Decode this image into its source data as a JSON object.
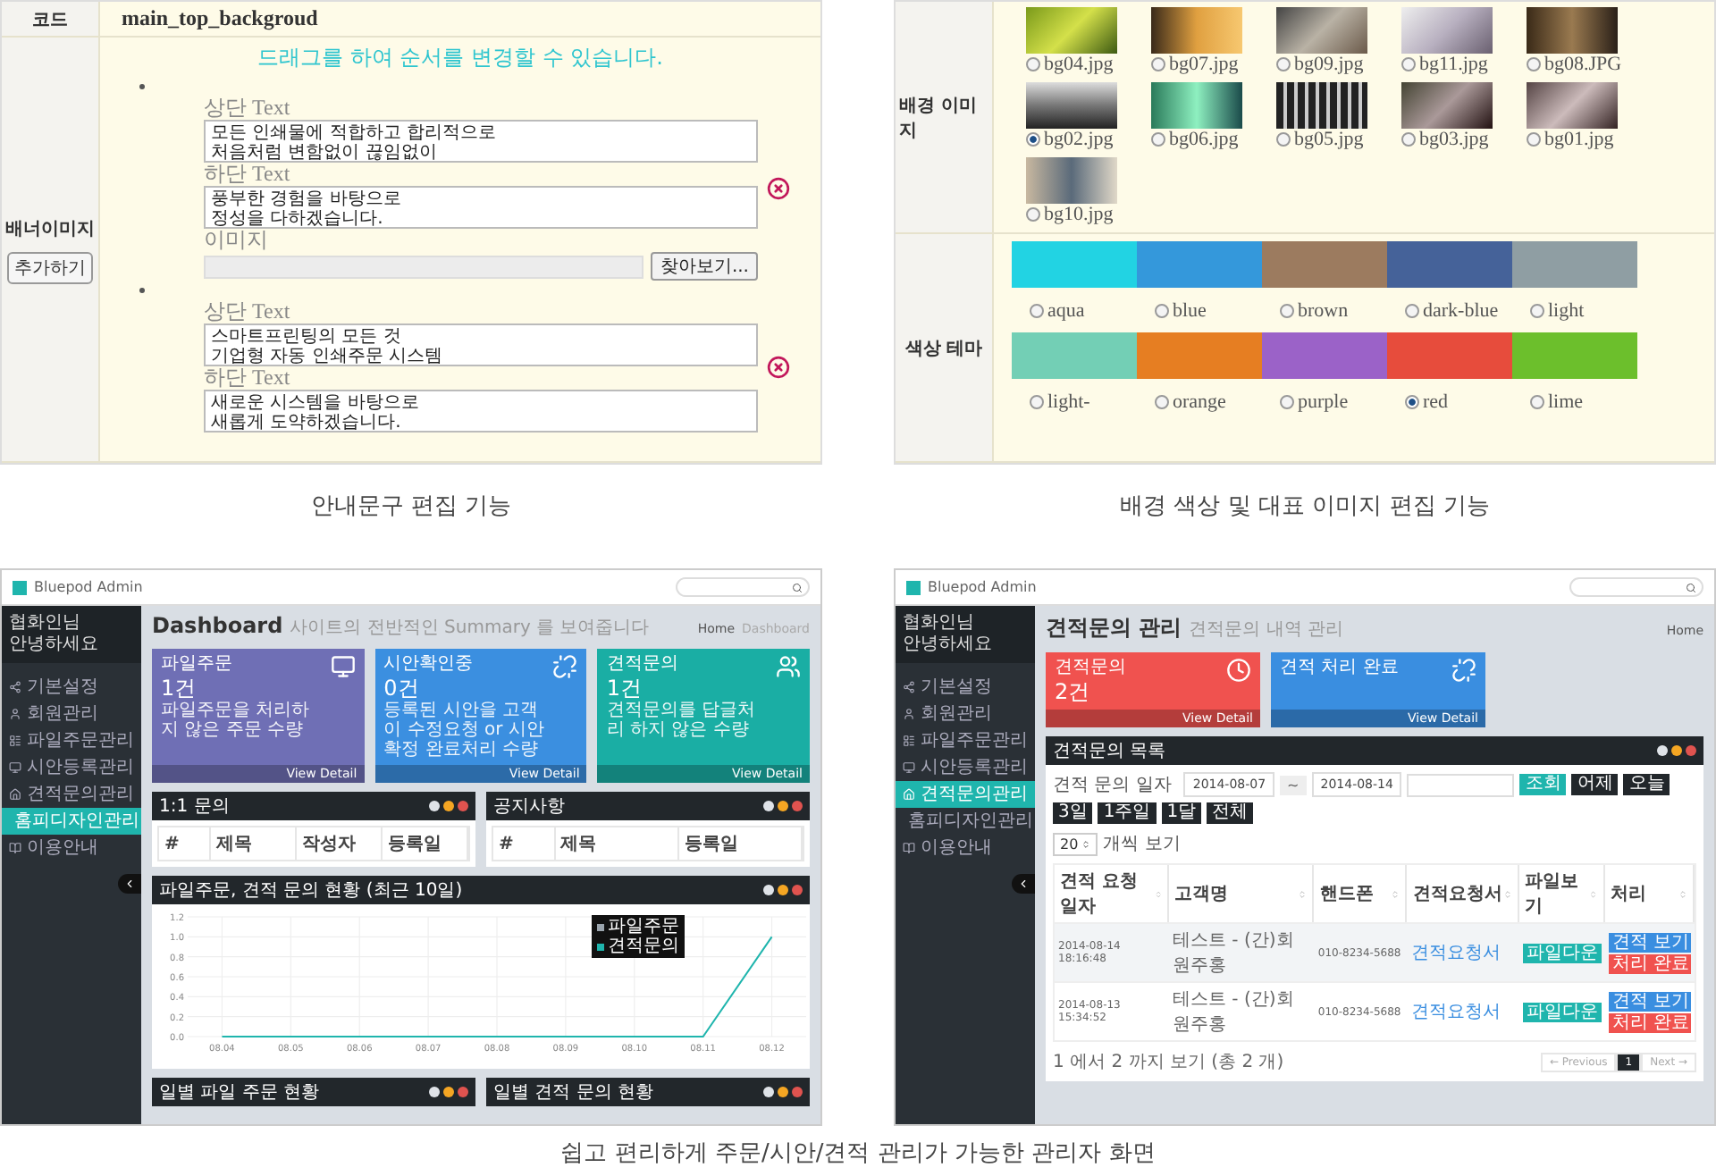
{
  "banner_editor": {
    "code_label": "코드",
    "code_value": "main_top_backgroud",
    "field_label": "배너이미지",
    "add_button": "추가하기",
    "hint": "드래그를 하여 순서를 변경할 수 있습니다.",
    "items": [
      {
        "top_label": "상단 Text",
        "top_text": "모든 인쇄물에 적합하고 합리적으로\n처음처럼 변함없이 끊임없이",
        "bottom_label": "하단 Text",
        "bottom_text": "풍부한 경험을 바탕으로\n정성을 다하겠습니다.",
        "image_label": "이미지",
        "browse_button": "찾아보기..."
      },
      {
        "top_label": "상단 Text",
        "top_text": "스마트프린팅의 모든 것\n기업형 자동 인쇄주문 시스템",
        "bottom_label": "하단 Text",
        "bottom_text": "새로운 시스템을 바탕으로\n새롭게 도약하겠습니다."
      }
    ],
    "caption": "안내문구 편집 기능"
  },
  "theme_editor": {
    "image_label": "배경 이미지",
    "images": [
      {
        "name": "bg04.jpg",
        "selected": false
      },
      {
        "name": "bg07.jpg",
        "selected": false
      },
      {
        "name": "bg09.jpg",
        "selected": false
      },
      {
        "name": "bg11.jpg",
        "selected": false
      },
      {
        "name": "bg08.JPG",
        "selected": false
      },
      {
        "name": "bg02.jpg",
        "selected": true
      },
      {
        "name": "bg06.jpg",
        "selected": false
      },
      {
        "name": "bg05.jpg",
        "selected": false
      },
      {
        "name": "bg03.jpg",
        "selected": false
      },
      {
        "name": "bg01.jpg",
        "selected": false
      },
      {
        "name": "bg10.jpg",
        "selected": false
      }
    ],
    "color_label": "색상 테마",
    "colors": [
      {
        "name": "aqua",
        "color": "#22d3e3",
        "selected": false
      },
      {
        "name": "blue",
        "color": "#3498db",
        "selected": false
      },
      {
        "name": "brown",
        "color": "#9c7b5f",
        "selected": false
      },
      {
        "name": "dark-blue",
        "color": "#456299",
        "selected": false
      },
      {
        "name": "light",
        "color": "#8f9ea3",
        "selected": false
      },
      {
        "name": "light-",
        "color": "#73cfb5",
        "selected": false
      },
      {
        "name": "orange",
        "color": "#e67e22",
        "selected": false
      },
      {
        "name": "purple",
        "color": "#9b62c8",
        "selected": false
      },
      {
        "name": "red",
        "color": "#e74c3c",
        "selected": true
      },
      {
        "name": "lime",
        "color": "#6cbf2c",
        "selected": false
      }
    ],
    "caption": "배경 색상 및 대표 이미지 편집 기능"
  },
  "dashboard_screen": {
    "app_title": "Bluepod Admin",
    "user_name": "협화인님",
    "user_greeting": "안녕하세요",
    "menu": [
      {
        "label": "기본설정",
        "selected": false
      },
      {
        "label": "회원관리",
        "selected": false
      },
      {
        "label": "파일주문관리",
        "selected": false
      },
      {
        "label": "시안등록관리",
        "selected": false
      },
      {
        "label": "견적문의관리",
        "selected": false
      },
      {
        "label": "홈피디자인관리",
        "selected": true
      },
      {
        "label": "이용안내",
        "selected": false
      }
    ],
    "page_title": "Dashboard",
    "page_subtitle": "사이트의 전반적인 Summary 를 보여줍니다",
    "breadcrumb": [
      "Home",
      "Dashboard"
    ],
    "stats": [
      {
        "title": "파일주문",
        "value": "1건",
        "desc": "파일주문을 처리하지 않은 주문 수량",
        "link": "View Detail",
        "color": "#6f6fb5"
      },
      {
        "title": "시안확인중",
        "value": "0건",
        "desc": "등록된 시안을 고객이 수정요청 or 시안 확정 완료처리 수량",
        "link": "View Detail",
        "color": "#3b8fe0"
      },
      {
        "title": "견적문의",
        "value": "1건",
        "desc": "견적문의를 답글처리 하지 않은 수량",
        "link": "View Detail",
        "color": "#1aaea4"
      }
    ],
    "tables": [
      {
        "title": "1:1 문의",
        "columns": [
          "#",
          "제목",
          "작성자",
          "등록일"
        ]
      },
      {
        "title": "공지사항",
        "columns": [
          "#",
          "제목",
          "등록일"
        ]
      }
    ],
    "chart_panel": {
      "title": "파일주문, 견적 문의 현황 (최근 10일)",
      "chart_data": {
        "type": "line",
        "x": [
          "08.04",
          "08.05",
          "08.06",
          "08.07",
          "08.08",
          "08.09",
          "08.10",
          "08.11",
          "08.12"
        ],
        "series": [
          {
            "name": "파일주문",
            "color": "#9aa4ad",
            "values": [
              null,
              null,
              null,
              null,
              null,
              null,
              null,
              null,
              null
            ]
          },
          {
            "name": "견적문의",
            "color": "#1fb5ad",
            "values": [
              0,
              0,
              0,
              0,
              0,
              0,
              0,
              0,
              1
            ]
          }
        ],
        "grid": true,
        "legend": true,
        "ylim": [
          0,
          1.2
        ],
        "yticks": [
          {
            "value": 0,
            "label": "0.0"
          },
          {
            "value": 0.2,
            "label": "0.2"
          },
          {
            "value": 0.4,
            "label": "0.4"
          },
          {
            "value": 0.6,
            "label": "0.6"
          },
          {
            "value": 0.8,
            "label": "0.8"
          },
          {
            "value": 1,
            "label": "1.0"
          },
          {
            "value": 1.2,
            "label": "1.2"
          }
        ]
      }
    },
    "bottom_panels": [
      "일별 파일 주문 현황",
      "일별 견적 문의 현황"
    ]
  },
  "quote_screen": {
    "app_title": "Bluepod Admin",
    "user_name": "협화인님",
    "user_greeting": "안녕하세요",
    "menu": [
      {
        "label": "기본설정",
        "selected": false
      },
      {
        "label": "회원관리",
        "selected": false
      },
      {
        "label": "파일주문관리",
        "selected": false
      },
      {
        "label": "시안등록관리",
        "selected": false
      },
      {
        "label": "견적문의관리",
        "selected": true
      },
      {
        "label": "홈피디자인관리",
        "selected": false
      },
      {
        "label": "이용안내",
        "selected": false
      }
    ],
    "page_title": "견적문의 관리",
    "page_subtitle": "견적문의 내역 관리",
    "breadcrumb": [
      "Home"
    ],
    "stats": [
      {
        "title": "견적문의",
        "value": "2건",
        "link": "View Detail",
        "color": "#f0524f"
      },
      {
        "title": "견적 처리 완료",
        "link": "View Detail",
        "color": "#3a8ee0"
      }
    ],
    "list_panel": {
      "title": "견적문의 목록",
      "date_label": "견적 문의 일자",
      "date_from": "2014-08-07",
      "date_sep": "~",
      "date_to": "2014-08-14",
      "search_button": "조회",
      "range_buttons": [
        "어제",
        "오늘",
        "3일",
        "1주일",
        "1달",
        "전체"
      ],
      "page_size": "20",
      "page_size_label": "개씩 보기",
      "columns": [
        "견적 요청일자",
        "고객명",
        "핸드폰",
        "견적요청서",
        "파일보기",
        "처리"
      ],
      "rows": [
        {
          "date": "2014-08-14 18:16:48",
          "customer": "테스트 - (간)회원주홍",
          "phone": "010-8234-5688",
          "request": "견적요청서",
          "file_button": "파일다운",
          "actions": [
            "견적 보기",
            "처리 완료"
          ]
        },
        {
          "date": "2014-08-13 15:34:52",
          "customer": "테스트 - (간)회원주홍",
          "phone": "010-8234-5688",
          "request": "견적요청서",
          "file_button": "파일다운",
          "actions": [
            "견적 보기",
            "처리 완료"
          ]
        }
      ],
      "summary": "1 에서 2 까지 보기 (총 2 개)",
      "pagination": [
        {
          "label": "← Previous",
          "selected": false
        },
        {
          "label": "1",
          "selected": true
        },
        {
          "label": "Next →",
          "selected": false
        }
      ]
    }
  },
  "bottom_caption": "쉽고 편리하게 주문/시안/견적 관리가 가능한 관리자 화면"
}
